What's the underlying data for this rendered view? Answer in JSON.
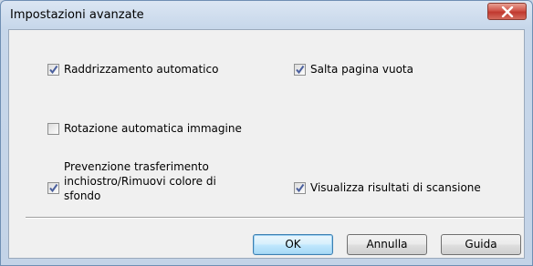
{
  "window": {
    "title": "Impostazioni avanzate"
  },
  "options": {
    "auto_deskew": {
      "label": "Raddrizzamento automatico",
      "checked": true
    },
    "skip_blank_page": {
      "label": "Salta pagina vuota",
      "checked": true
    },
    "auto_image_rotation": {
      "label": "Rotazione automatica immagine",
      "checked": false
    },
    "bleed_through": {
      "label_line1": "Prevenzione trasferimento",
      "label_line2": "inchiostro/Rimuovi colore di",
      "label_line3": "sfondo",
      "checked": true
    },
    "display_scan_results": {
      "label": "Visualizza risultati di scansione",
      "checked": true
    }
  },
  "buttons": {
    "ok": "OK",
    "cancel": "Annulla",
    "help": "Guida"
  },
  "colors": {
    "check_mark": "#4a5f9d",
    "title_bar": "#c7d7ea",
    "close_button": "#c9463a"
  }
}
